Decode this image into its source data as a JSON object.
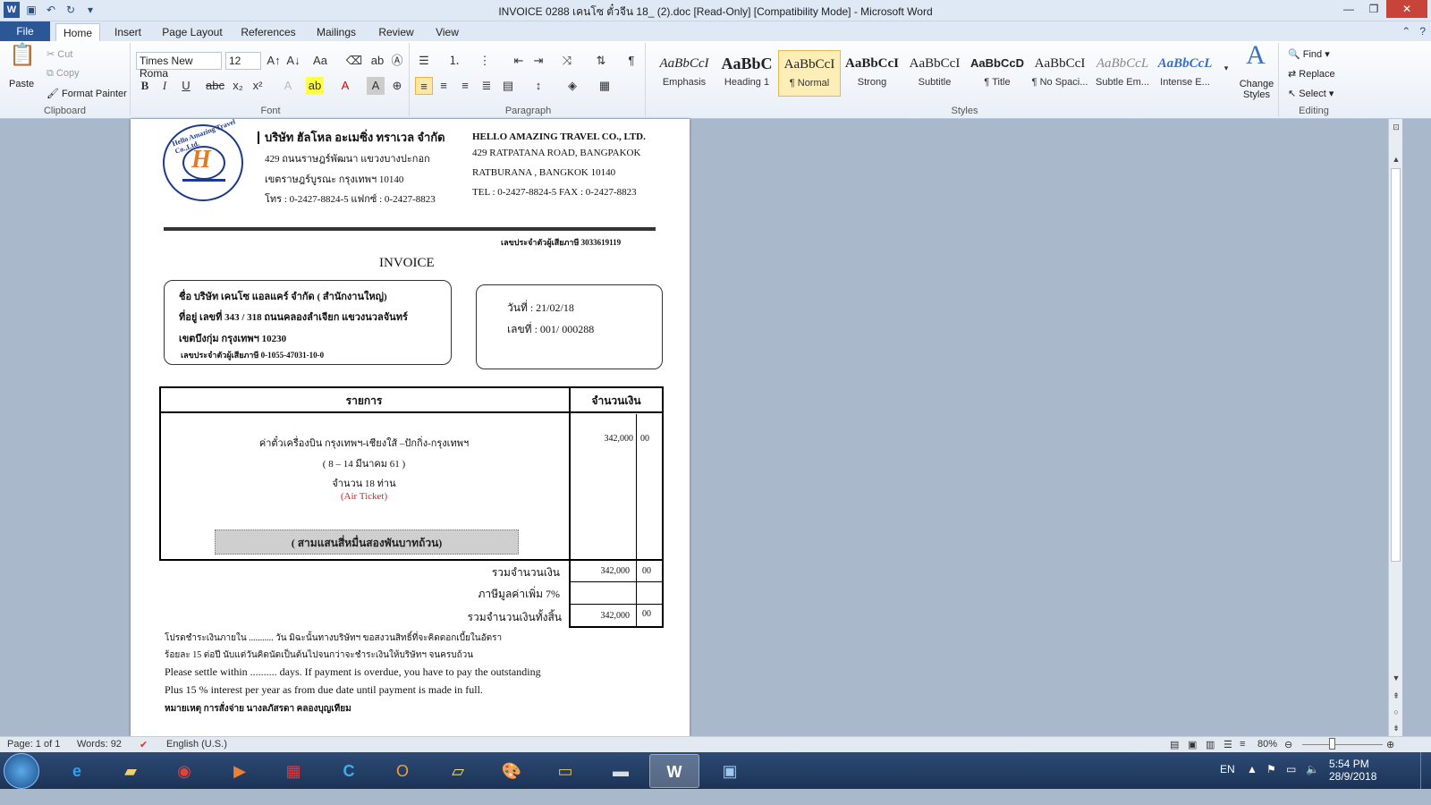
{
  "window": {
    "title": "INVOICE 0288 เคนโซ ตั๋วจีน 18_ (2).doc [Read-Only] [Compatibility Mode] - Microsoft Word"
  },
  "tabs": [
    "File",
    "Home",
    "Insert",
    "Page Layout",
    "References",
    "Mailings",
    "Review",
    "View"
  ],
  "clipboard": {
    "paste": "Paste",
    "cut": "Cut",
    "copy": "Copy",
    "format_painter": "Format Painter",
    "label": "Clipboard"
  },
  "font": {
    "name": "Times New Roma",
    "size": "12",
    "label": "Font"
  },
  "paragraph": {
    "label": "Paragraph"
  },
  "styles": {
    "label": "Styles",
    "items": [
      {
        "sample": "AaBbCcI",
        "name": "Emphasis"
      },
      {
        "sample": "AaBbC",
        "name": "Heading 1"
      },
      {
        "sample": "AaBbCcI",
        "name": "¶ Normal"
      },
      {
        "sample": "AaBbCcI",
        "name": "Strong"
      },
      {
        "sample": "AaBbCcI",
        "name": "Subtitle"
      },
      {
        "sample": "AaBbCcD",
        "name": "¶ Title"
      },
      {
        "sample": "AaBbCcI",
        "name": "¶ No Spaci..."
      },
      {
        "sample": "AaBbCcL",
        "name": "Subtle Em..."
      },
      {
        "sample": "AaBbCcL",
        "name": "Intense E..."
      }
    ],
    "change_styles": "Change Styles"
  },
  "editing": {
    "label": "Editing",
    "find": "Find",
    "replace": "Replace",
    "select": "Select"
  },
  "doc": {
    "company_th": "บริษัท ฮัลโหล อะเมซิ่ง ทราเวล จำกัด",
    "addr_th_1": "429 ถนนราษฎร์พัฒนา  แขวงบางปะกอก",
    "addr_th_2": "เขตราษฎร์บูรณะ  กรุงเทพฯ 10140",
    "phone_th": "โทร : 0-2427-8824-5   แฟกซ์ : 0-2427-8823",
    "company_en": "HELLO AMAZING TRAVEL CO., LTD.",
    "addr_en_1": "429   RATPATANA ROAD, BANGPAKOK",
    "addr_en_2": "RATBURANA , BANGKOK  10140",
    "phone_en": "TEL : 0-2427-8824-5   FAX : 0-2427-8823",
    "tax_id": "เลขประจำตัวผู้เสียภาษี 3033619119",
    "heading": "INVOICE",
    "customer": {
      "name": "ชื่อ    บริษัท เคนโซ แอลแคร์  จำกัด ( สำนักงานใหญ่)",
      "addr1": "ที่อยู่  เลขที่ 343 / 318 ถนนคลองลำเจียก แขวงนวลจันทร์",
      "addr2": "เขตบึงกุ่ม  กรุงเทพฯ 10230",
      "tax": "เลขประจำตัวผู้เสียภาษี 0-1055-47031-10-0"
    },
    "date": "วันที่  :  21/02/18",
    "number": "เลขที่ : 001/ 000288",
    "col_item": "รายการ",
    "col_amount": "จำนวนเงิน",
    "item_line1": "ค่าตั๋วเครื่องบิน กรุงเทพฯ-เชียงใส้ –ปักกิ่ง-กรุงเทพฯ",
    "item_line2": "( 8  – 14 มีนาคม 61 )",
    "item_line3": "จำนวน 18 ท่าน",
    "item_line4": "(Air Ticket)",
    "amount": "342,000",
    "satang": "00",
    "amount_words": "( สามแสนสี่หมื่นสองพันบาทถ้วน)",
    "subtotal_label": "รวมจำนวนเงิน",
    "subtotal": "342,000",
    "subtotal_satang": "00",
    "vat_label": "ภาษีมูลค่าเพิ่ม 7%",
    "total_label": "รวมจำนวนเงินทั้งสิ้น",
    "total": "342,000",
    "total_satang": "00",
    "note_th_1": "โปรดชำระเงินภายใน ........... วัน มิฉะนั้นทางบริษัทฯ ขอสงวนสิทธิ์ที่จะคิดดอกเบี้ยในอัตรา",
    "note_th_2": "ร้อยละ 15 ต่อปี  นับแต่วันคิดนัดเป็นต้นไปจนกว่าจะชำระเงินให้บริษัทฯ จนครบถ้วน",
    "note_en_1": "Please settle within .......... days. If payment is overdue, you have to pay the outstanding",
    "note_en_2": "Plus 15 % interest  per year as from due date until payment is made in full.",
    "remark": "หมายเหตุ  การสั่งจ่าย นางลภัสรดา  คลองบุญเทียม"
  },
  "status": {
    "page": "Page: 1 of 1",
    "words": "Words: 92",
    "lang": "English (U.S.)",
    "zoom": "80%"
  },
  "tray": {
    "lang": "EN",
    "time": "5:54 PM",
    "date": "28/9/2018"
  }
}
